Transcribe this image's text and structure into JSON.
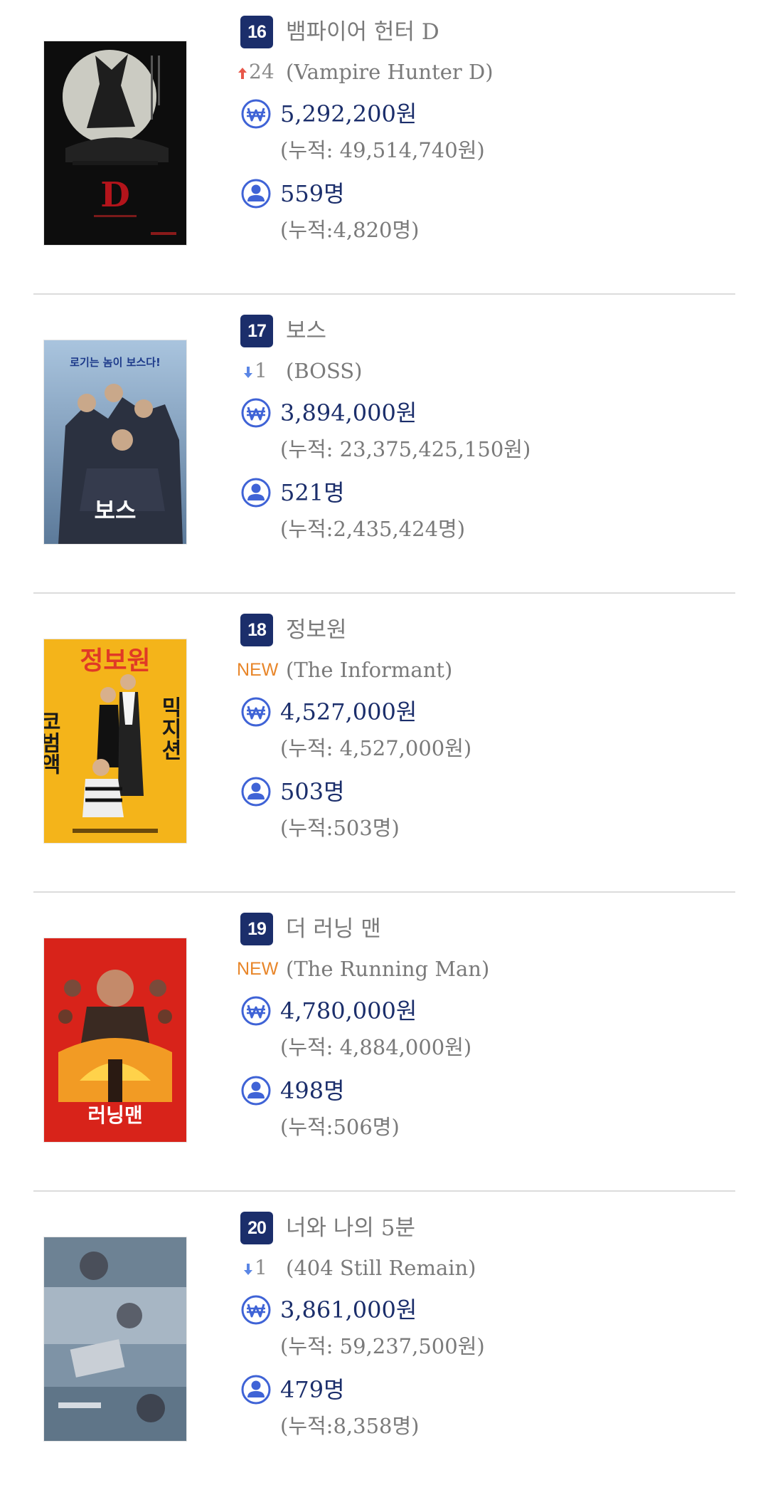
{
  "movies": [
    {
      "rank": "16",
      "title_ko": "뱀파이어 헌터 D",
      "change": "24",
      "change_type": "up",
      "title_en": "(Vampire Hunter D)",
      "sales": "5,292,200원",
      "sales_cumulative": "(누적: 49,514,740원)",
      "audience": "559명",
      "audience_cumulative": "(누적:4,820명)"
    },
    {
      "rank": "17",
      "title_ko": "보스",
      "change": "1",
      "change_type": "down",
      "title_en": "(BOSS)",
      "sales": "3,894,000원",
      "sales_cumulative": "(누적: 23,375,425,150원)",
      "audience": "521명",
      "audience_cumulative": "(누적:2,435,424명)"
    },
    {
      "rank": "18",
      "title_ko": "정보원",
      "change": "NEW",
      "change_type": "new",
      "title_en": "(The Informant)",
      "sales": "4,527,000원",
      "sales_cumulative": "(누적: 4,527,000원)",
      "audience": "503명",
      "audience_cumulative": "(누적:503명)"
    },
    {
      "rank": "19",
      "title_ko": "더 러닝 맨",
      "change": "NEW",
      "change_type": "new",
      "title_en": "(The Running Man)",
      "sales": "4,780,000원",
      "sales_cumulative": "(누적: 4,884,000원)",
      "audience": "498명",
      "audience_cumulative": "(누적:506명)"
    },
    {
      "rank": "20",
      "title_ko": "너와 나의 5분",
      "change": "1",
      "change_type": "down",
      "title_en": "(404 Still Remain)",
      "sales": "3,861,000원",
      "sales_cumulative": "(누적: 59,237,500원)",
      "audience": "479명",
      "audience_cumulative": "(누적:8,358명)"
    }
  ],
  "colors": {
    "rank_badge": "#1b2e6b",
    "stat_value": "#1b2e6b",
    "icon_blue": "#3f63d6",
    "up_arrow": "#e8584a",
    "down_arrow": "#5b86e5",
    "new_label": "#e8862a",
    "divider": "#dcdcdc"
  },
  "icons": {
    "sales": "won-circle-icon",
    "audience": "person-circle-icon",
    "up": "arrow-up-icon",
    "down": "arrow-down-icon"
  },
  "posters": {
    "p16_caption": "D",
    "p17_tagline": "로기는 놈이 보스다!",
    "p17_title": "보스",
    "p18_title": "정보원",
    "p18_left": "코범액",
    "p18_right": "믹지션",
    "p19_title": "러닝맨"
  }
}
